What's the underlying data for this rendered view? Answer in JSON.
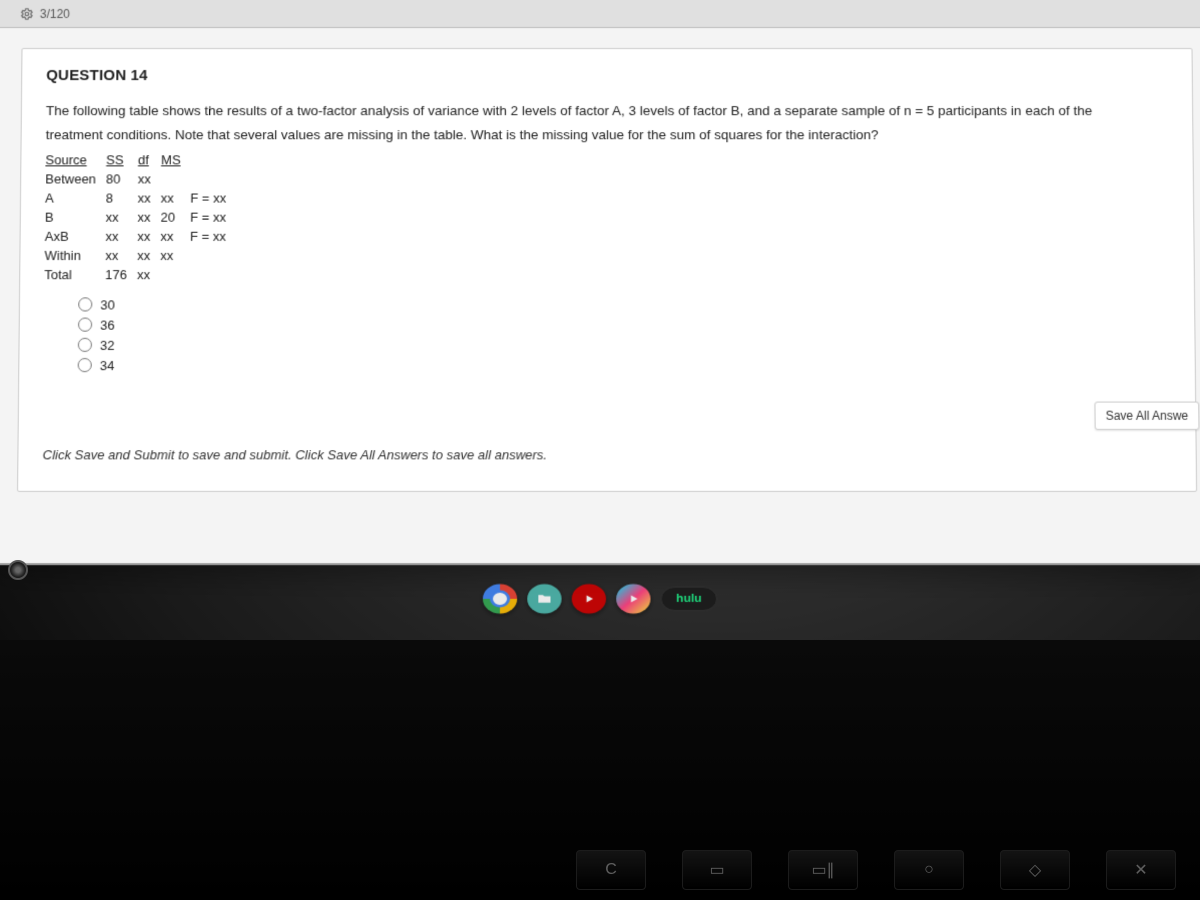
{
  "tab": {
    "label": "3/120"
  },
  "question": {
    "title": "QUESTION 14",
    "prompt_line1": "The following table shows the results of a two-factor analysis of variance with 2 levels of factor A, 3 levels of factor B, and a separate sample of  n = 5 participants in each of the",
    "prompt_line2": "treatment conditions. Note that several values are missing in the table. What is the missing value for the sum of squares for the interaction?"
  },
  "anova": {
    "headers": {
      "source": "Source",
      "ss": "SS",
      "df": "df",
      "ms": "MS",
      "f": ""
    },
    "rows": [
      {
        "source": "Between",
        "ss": "80",
        "df": "xx",
        "ms": "",
        "f": ""
      },
      {
        "source": "A",
        "ss": "8",
        "df": "xx",
        "ms": "xx",
        "f": "F = xx"
      },
      {
        "source": "B",
        "ss": "xx",
        "df": "xx",
        "ms": "20",
        "f": "F = xx"
      },
      {
        "source": "AxB",
        "ss": "xx",
        "df": "xx",
        "ms": "xx",
        "f": "F = xx"
      },
      {
        "source": "Within",
        "ss": "xx",
        "df": "xx",
        "ms": "xx",
        "f": ""
      },
      {
        "source": "Total",
        "ss": "176",
        "df": "xx",
        "ms": "",
        "f": ""
      }
    ]
  },
  "options": [
    "30",
    "36",
    "32",
    "34"
  ],
  "footer": "Click Save and Submit to save and submit. Click Save All Answers to save all answers.",
  "buttons": {
    "save_all": "Save All Answe"
  },
  "shelf": {
    "hulu": "hulu"
  },
  "keys": [
    "C",
    "▭",
    "▭∥",
    "○",
    "◇",
    "✕"
  ]
}
